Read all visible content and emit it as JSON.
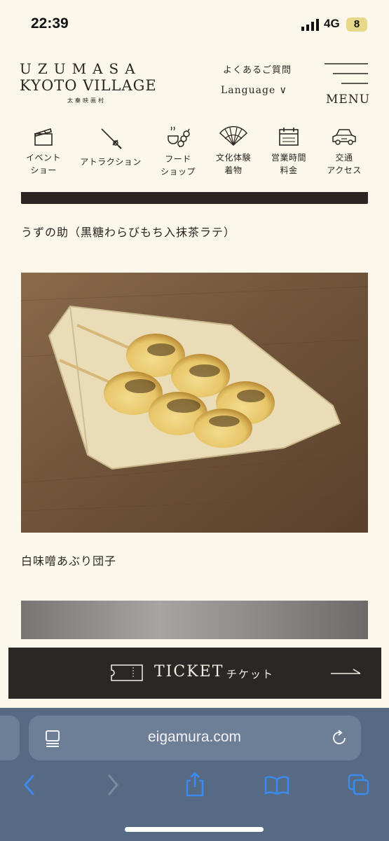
{
  "status": {
    "time": "22:39",
    "network": "4G",
    "battery": "8"
  },
  "header": {
    "logo_line1": "UZUMASA",
    "logo_line2": "KYOTO VILLAGE",
    "logo_jp": "太秦映画村",
    "faq": "よくあるご質問",
    "language": "Language ∨",
    "menu": "MENU"
  },
  "nav": {
    "items": [
      {
        "line1": "イベント",
        "line2": "ショー",
        "icon": "clapperboard-icon"
      },
      {
        "line1": "アトラクション",
        "line2": "",
        "icon": "sword-icon"
      },
      {
        "line1": "フード",
        "line2": "ショップ",
        "icon": "dango-icon"
      },
      {
        "line1": "文化体験",
        "line2": "着物",
        "icon": "fan-icon"
      },
      {
        "line1": "営業時間",
        "line2": "料金",
        "icon": "calendar-icon"
      },
      {
        "line1": "交通",
        "line2": "アクセス",
        "icon": "car-icon"
      }
    ]
  },
  "content": {
    "caption1": "うずの助（黒糖わらびもち入抹茶ラテ）",
    "caption2": "白味噌あぶり団子"
  },
  "ticket": {
    "label_en": "TICKET",
    "label_jp": "チケット"
  },
  "browser": {
    "url": "eigamura.com"
  },
  "colors": {
    "background": "#fbf7ea",
    "dark": "#2b2623",
    "browser": "#566a84"
  }
}
